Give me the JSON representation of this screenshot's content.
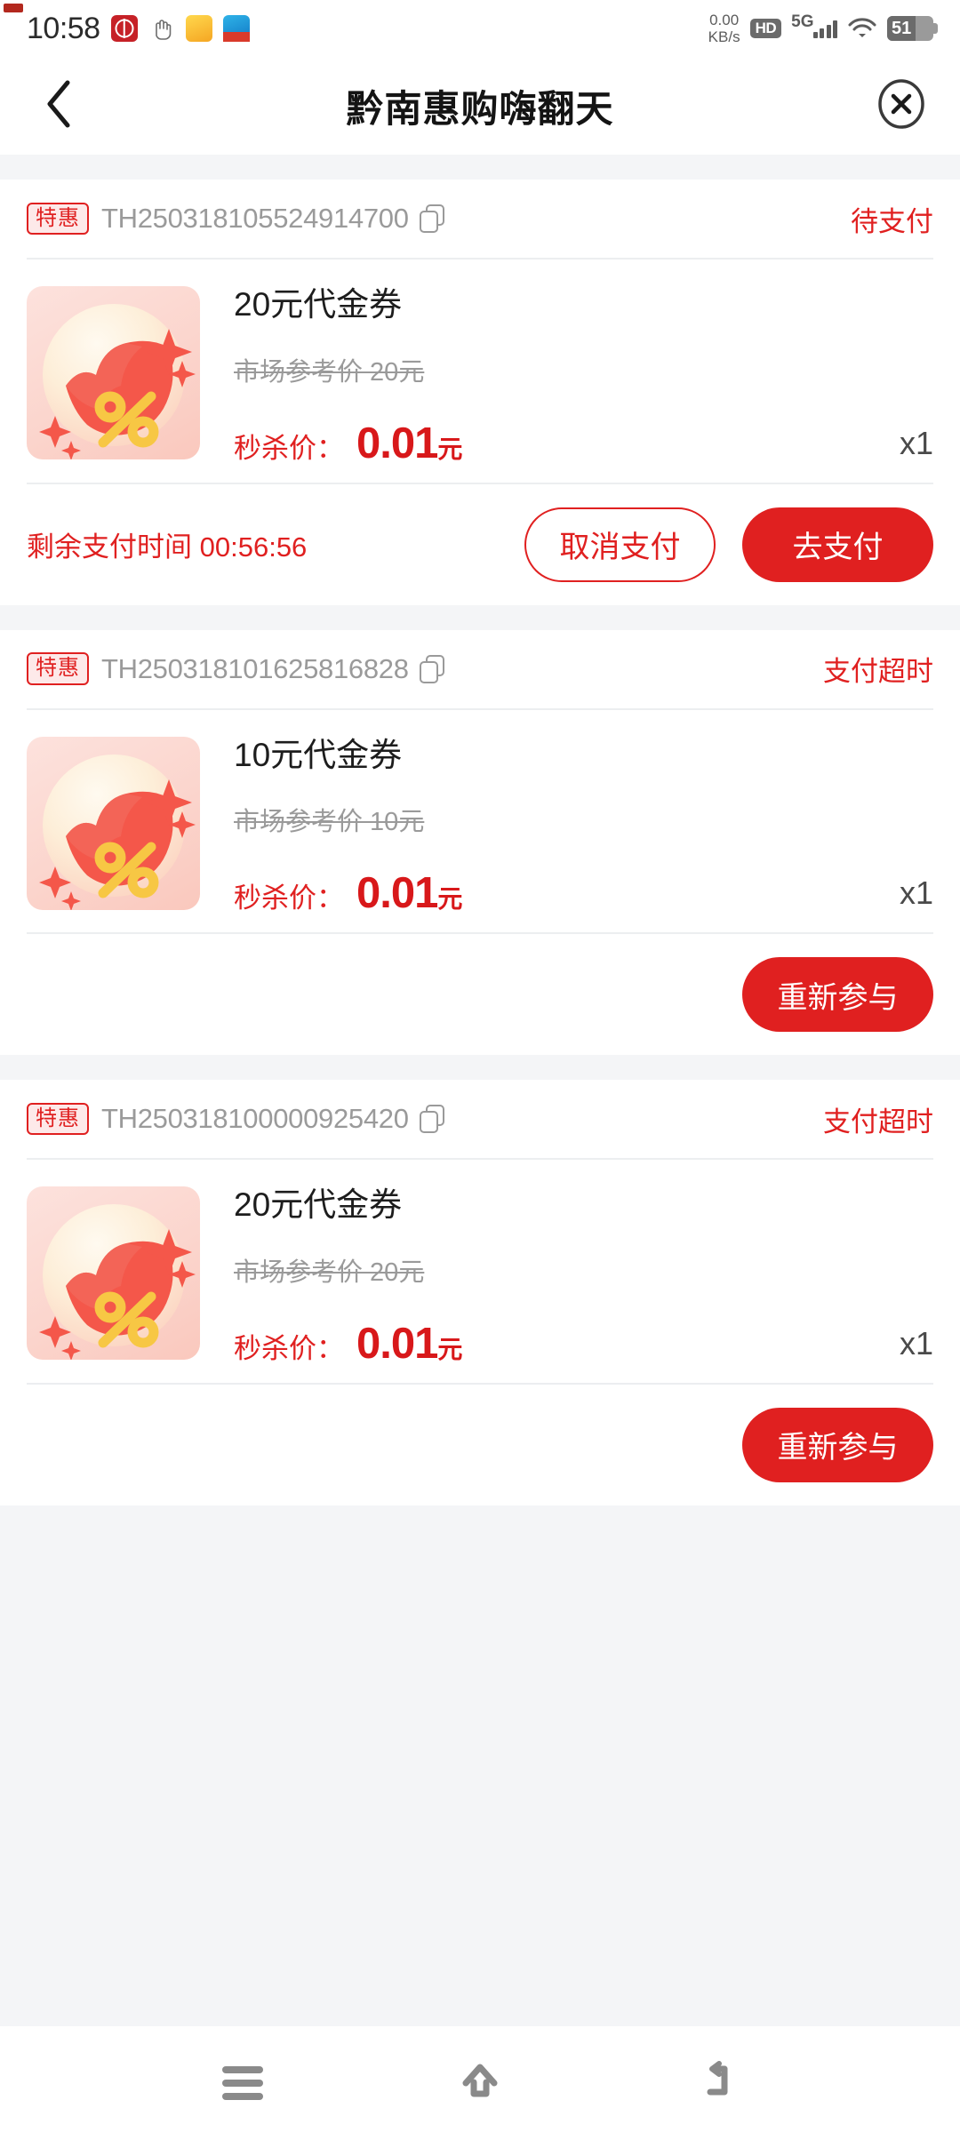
{
  "status_bar": {
    "time": "10:58",
    "net_speed_value": "0.00",
    "net_speed_unit": "KB/s",
    "hd_label": "HD",
    "network_label": "5G",
    "battery_level": "51",
    "app_icons": [
      "boc-app-icon",
      "hand-pointer-icon",
      "yellow-app-icon",
      "blue-app-icon"
    ]
  },
  "nav_bar": {
    "back_icon": "chevron-left-icon",
    "title": "黔南惠购嗨翻天",
    "close_icon": "close-circle-icon"
  },
  "orders": [
    {
      "tag": "特惠",
      "order_no": "TH250318105524914700",
      "copy_icon": "copy-icon",
      "status": "待支付",
      "product_name": "20元代金券",
      "market_ref": "市场参考价 20元",
      "price_label": "秒杀价：",
      "price_value": "0.01",
      "price_unit": "元",
      "quantity": "x1",
      "countdown_label": "剩余支付时间",
      "countdown_value": "00:56:56",
      "buttons": [
        {
          "label": "取消支付",
          "style": "ghost"
        },
        {
          "label": "去支付",
          "style": "solid"
        }
      ]
    },
    {
      "tag": "特惠",
      "order_no": "TH250318101625816828",
      "copy_icon": "copy-icon",
      "status": "支付超时",
      "product_name": "10元代金券",
      "market_ref": "市场参考价 10元",
      "price_label": "秒杀价：",
      "price_value": "0.01",
      "price_unit": "元",
      "quantity": "x1",
      "countdown_label": "",
      "countdown_value": "",
      "buttons": [
        {
          "label": "重新参与",
          "style": "solid"
        }
      ]
    },
    {
      "tag": "特惠",
      "order_no": "TH250318100000925420",
      "copy_icon": "copy-icon",
      "status": "支付超时",
      "product_name": "20元代金券",
      "market_ref": "市场参考价 20元",
      "price_label": "秒杀价：",
      "price_value": "0.01",
      "price_unit": "元",
      "quantity": "x1",
      "countdown_label": "",
      "countdown_value": "",
      "buttons": [
        {
          "label": "重新参与",
          "style": "solid"
        }
      ]
    }
  ],
  "android_nav": {
    "recents_icon": "menu-icon",
    "home_icon": "home-icon",
    "back_icon": "back-arrow-icon"
  },
  "colors": {
    "accent_red": "#e02020",
    "price_red": "#d8181a",
    "page_bg": "#f4f5f7",
    "card_bg": "#ffffff",
    "muted_text": "#9a9a9a"
  }
}
